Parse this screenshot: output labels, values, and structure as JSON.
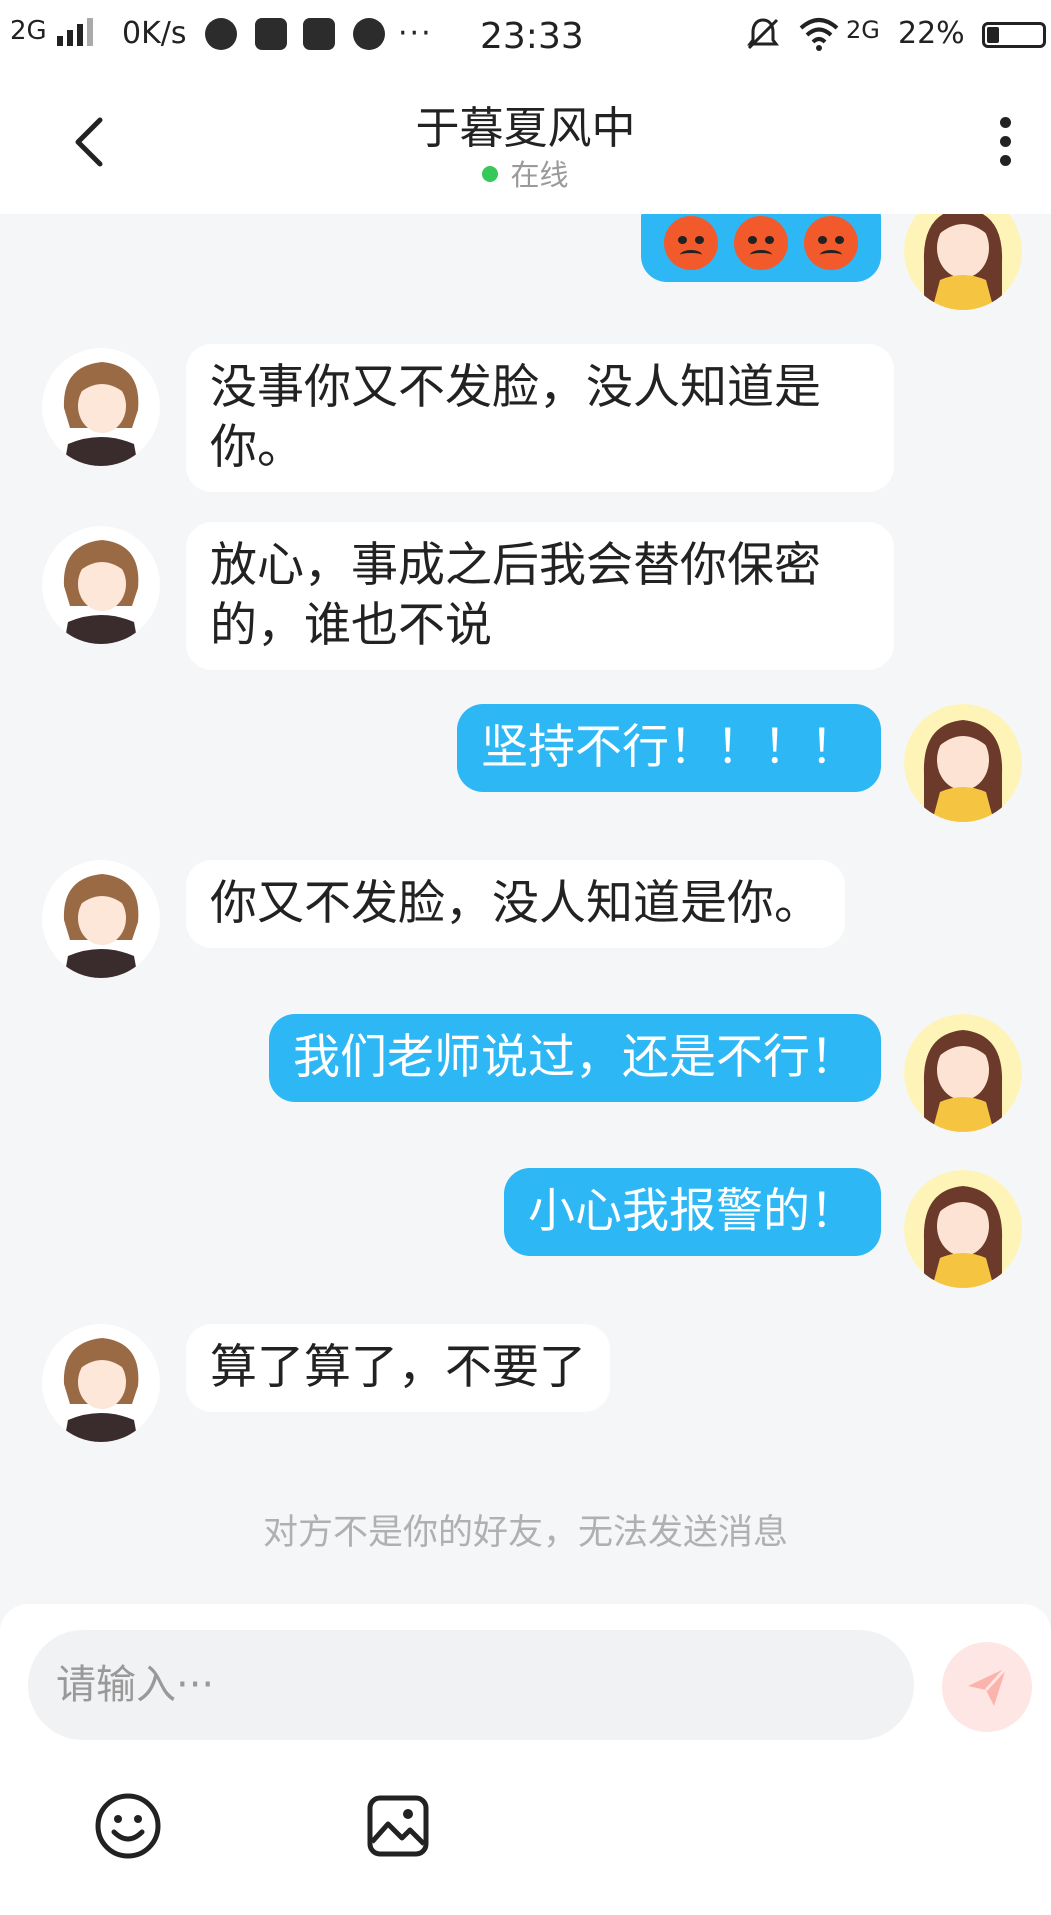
{
  "status_bar": {
    "network": "2G",
    "speed": "0K/s",
    "dots": "···",
    "time": "23:33",
    "network2": "2G",
    "battery_pct": "22%",
    "battery_level": 0.22
  },
  "header": {
    "title": "于暮夏风中",
    "status": "在线",
    "status_color": "#36c95a"
  },
  "messages": [
    {
      "side": "out",
      "text": "",
      "emojis": [
        "angry-emoji",
        "angry-emoji",
        "angry-emoji"
      ]
    },
    {
      "side": "in",
      "text": "没事你又不发脸，没人知道是你。"
    },
    {
      "side": "in",
      "text": "放心，事成之后我会替你保密的，谁也不说"
    },
    {
      "side": "out",
      "text": "坚持不行！！！！"
    },
    {
      "side": "in",
      "text": "你又不发脸，没人知道是你。"
    },
    {
      "side": "out",
      "text": "我们老师说过，还是不行！"
    },
    {
      "side": "out",
      "text": "小心我报警的！"
    },
    {
      "side": "in",
      "text": "算了算了，不要了"
    }
  ],
  "notice": "对方不是你的好友，无法发送消息",
  "composer": {
    "placeholder": "请输入···",
    "send_icon": "send-icon",
    "tools": [
      "emoji-icon",
      "image-icon"
    ]
  },
  "colors": {
    "outgoing_bubble": "#2db7f5",
    "incoming_bubble": "#ffffff",
    "background": "#f5f6f8"
  }
}
